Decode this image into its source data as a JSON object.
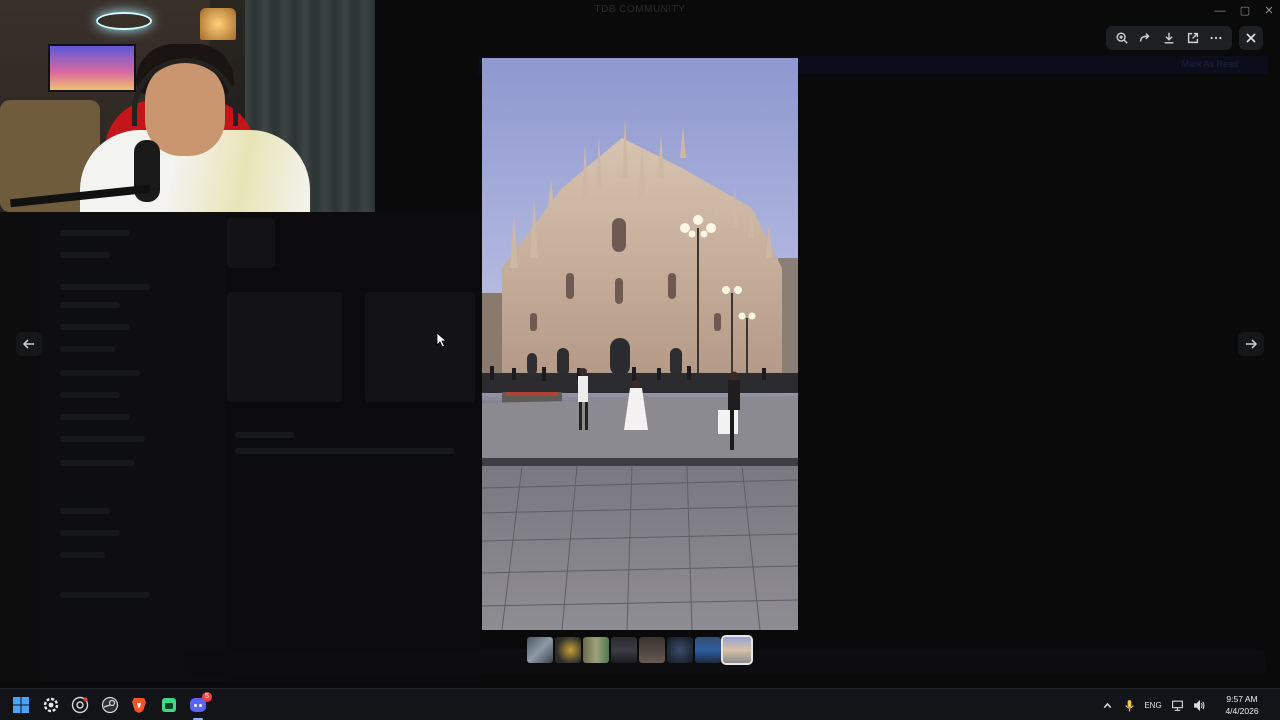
{
  "window": {
    "title": "TDB COMMUNITY",
    "controls": [
      "minimize",
      "maximize",
      "close"
    ]
  },
  "background": {
    "banner_text": "Mark As Read"
  },
  "viewer": {
    "toolbar": [
      {
        "name": "zoom-in",
        "label": "Zoom"
      },
      {
        "name": "forward",
        "label": "Forward"
      },
      {
        "name": "download",
        "label": "Download"
      },
      {
        "name": "open-in-browser",
        "label": "Open in Browser"
      },
      {
        "name": "more",
        "label": "More"
      }
    ],
    "close_icon": "close-icon",
    "prev_icon": "arrow-left-icon",
    "next_icon": "arrow-right-icon",
    "photo_subject": "Milan Cathedral (Duomo di Milano) at dusk",
    "thumbnail_count": 8,
    "selected_thumbnail": 8
  },
  "taskbar": {
    "apps": [
      "windows-start",
      "settings",
      "chrome",
      "steam",
      "brave",
      "android-app",
      "discord"
    ],
    "discord_badge": "5",
    "tray": {
      "lang": "ENG",
      "time": "9:57 AM",
      "date": "4/4/2026"
    }
  },
  "colors": {
    "viewer_bg": "#000000",
    "toolbar_bg": "#1e1f22",
    "taskbar_bg": "#121418",
    "discord_blurple": "#5865f2",
    "brave_orange": "#fb542b"
  }
}
